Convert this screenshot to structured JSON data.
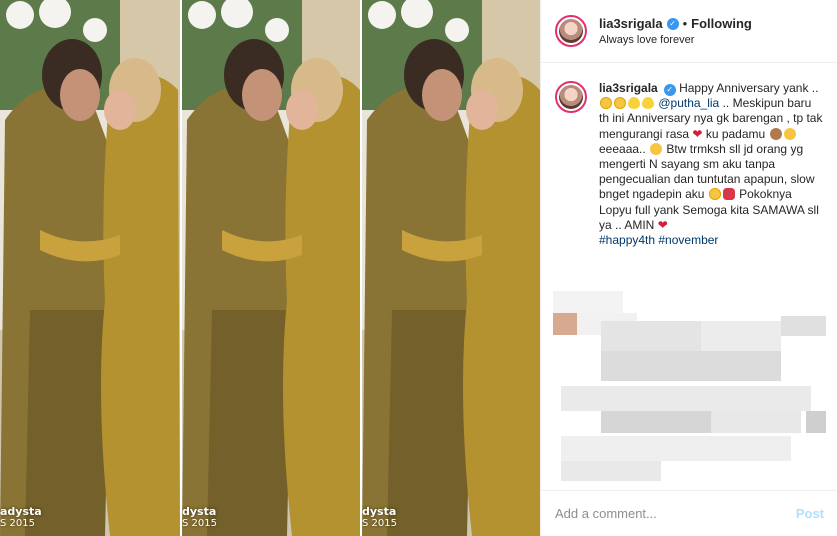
{
  "header": {
    "username": "lia3srigala",
    "verified_icon": "verified-badge-icon",
    "separator": "•",
    "follow_status": "Following",
    "location": "Always love forever"
  },
  "photo": {
    "watermark_line1": "dysta",
    "watermark_line2": "S 2015",
    "watermark_line1_b": "adysta",
    "watermark_line2_b": "S 2015"
  },
  "caption": {
    "username": "lia3srigala",
    "part1": "Happy Anniversary yank ..",
    "mention": "@putha_lia",
    "part2": ".. Meskipun baru th ini Anniversary nya gk barengan , tp tak mengurangi rasa",
    "part3": "ku padamu",
    "part4": "eeeaaa..",
    "part5": "Btw trmksh sll jd orang yg mengerti N sayang sm aku tanpa pengecualian dan tuntutan apapun, slow bnget ngadepin aku",
    "part6": "Pokoknya Lopyu full yank Semoga kita SAMAWA sll ya .. AMIN",
    "hashtags": "#happy4th #november"
  },
  "comment": {
    "placeholder": "Add a comment...",
    "post_label": "Post"
  },
  "colors": {
    "accent_link": "#00376b",
    "post_disabled": "#b2dffc",
    "verified": "#3897f0"
  }
}
